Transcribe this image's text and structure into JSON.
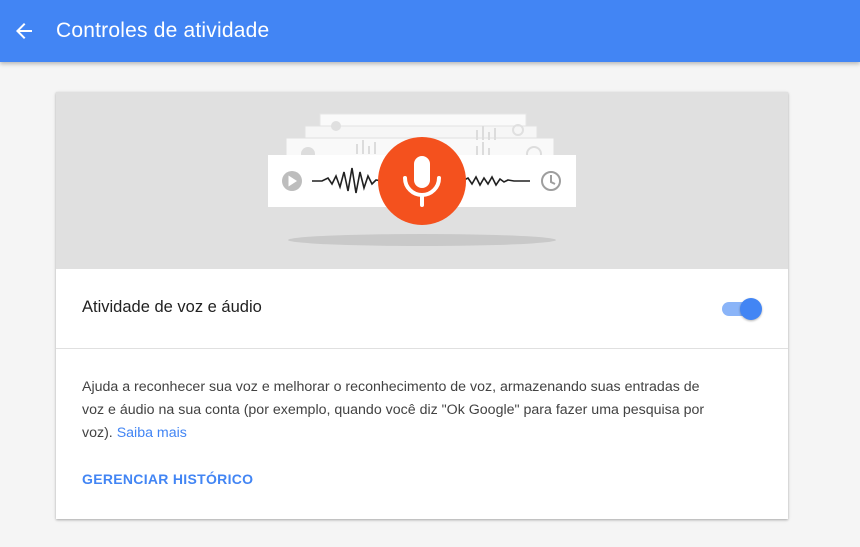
{
  "appbar": {
    "title": "Controles de atividade",
    "back_icon": "arrow-back-icon",
    "color": "#4285f4"
  },
  "card": {
    "illustration": {
      "icons": [
        "play-icon",
        "waveform",
        "microphone-icon",
        "clock-icon"
      ],
      "mic_color": "#f4511e"
    },
    "setting": {
      "label": "Atividade de voz e áudio",
      "toggle_on": true
    },
    "description": {
      "text": "Ajuda a reconhecer sua voz e melhorar o reconhecimento de voz, armazenando suas entradas de voz e áudio na sua conta (por exemplo, quando você diz \"Ok Google\" para fazer uma pesquisa por voz).",
      "link_label": "Saiba mais"
    },
    "manage_label": "GERENCIAR HISTÓRICO"
  }
}
